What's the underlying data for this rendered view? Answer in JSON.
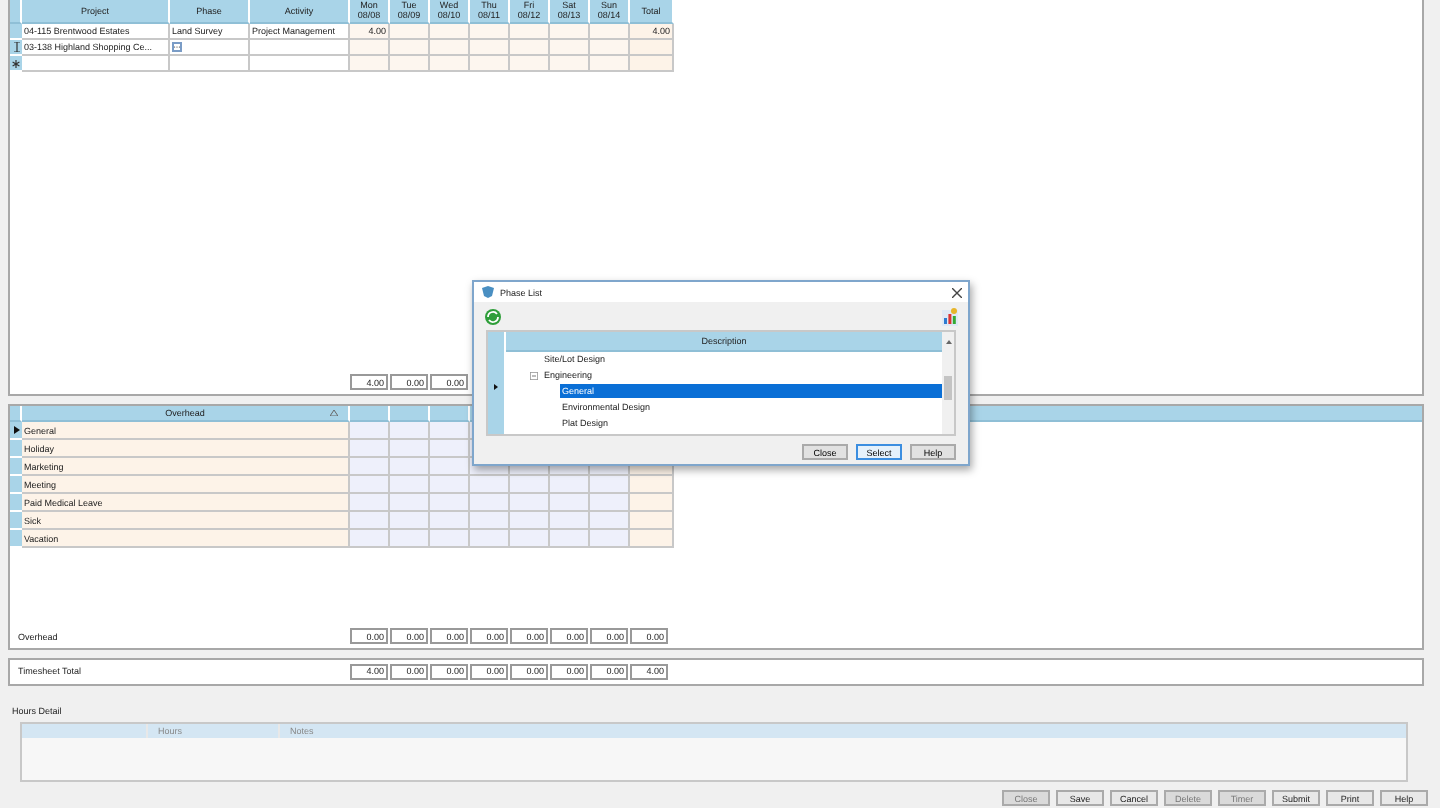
{
  "timesheet": {
    "columns": [
      "Project",
      "Phase",
      "Activity"
    ],
    "days": [
      {
        "day": "Mon",
        "date": "08/08"
      },
      {
        "day": "Tue",
        "date": "08/09"
      },
      {
        "day": "Wed",
        "date": "08/10"
      },
      {
        "day": "Thu",
        "date": "08/11"
      },
      {
        "day": "Fri",
        "date": "08/12"
      },
      {
        "day": "Sat",
        "date": "08/13"
      },
      {
        "day": "Sun",
        "date": "08/14"
      }
    ],
    "total_label": "Total",
    "rows": [
      {
        "editing": false,
        "new_row": false,
        "project": "04-115 Brentwood Estates",
        "phase": "Land Survey",
        "activity": "Project Management",
        "hours": {
          "mon": "4.00"
        },
        "total": "4.00",
        "phase_button": false
      },
      {
        "editing": true,
        "new_row": false,
        "project": "03-138 Highland Shopping Ce...",
        "phase_button": true
      },
      {
        "editing": false,
        "new_row": true,
        "phase_button": false
      }
    ],
    "totals": [
      "4.00",
      "0.00",
      "0.00"
    ]
  },
  "overhead": {
    "title": "Overhead",
    "rows": [
      {
        "name": "General",
        "current": true
      },
      {
        "name": "Holiday",
        "current": false
      },
      {
        "name": "Marketing",
        "current": false
      },
      {
        "name": "Meeting",
        "current": false
      },
      {
        "name": "Paid Medical Leave",
        "current": false
      },
      {
        "name": "Sick",
        "current": false
      },
      {
        "name": "Vacation",
        "current": false
      }
    ],
    "totals_label": "Overhead",
    "totals": [
      "0.00",
      "0.00",
      "0.00",
      "0.00",
      "0.00",
      "0.00",
      "0.00",
      "0.00"
    ]
  },
  "timesheet_total": {
    "label": "Timesheet Total",
    "values": [
      "4.00",
      "0.00",
      "0.00",
      "0.00",
      "0.00",
      "0.00",
      "0.00",
      "4.00"
    ]
  },
  "hours_detail": {
    "title": "Hours Detail",
    "columns": [
      "Hours",
      "Notes"
    ]
  },
  "buttons": [
    {
      "label": "Close",
      "disabled": true
    },
    {
      "label": "Save",
      "disabled": false
    },
    {
      "label": "Cancel",
      "disabled": false
    },
    {
      "label": "Delete",
      "disabled": true
    },
    {
      "label": "Timer",
      "disabled": true
    },
    {
      "label": "Submit",
      "disabled": false
    },
    {
      "label": "Print",
      "disabled": false
    },
    {
      "label": "Help",
      "disabled": false
    }
  ],
  "dialog": {
    "title": "Phase List",
    "column": "Description",
    "items": [
      {
        "label": "Site/Lot Design",
        "kind": "leaf",
        "selected": false
      },
      {
        "label": "Engineering",
        "kind": "group",
        "expanded": true,
        "children": [
          {
            "label": "General",
            "kind": "leaf",
            "selected": true
          },
          {
            "label": "Environmental Design",
            "kind": "leaf",
            "selected": false
          },
          {
            "label": "Plat Design",
            "kind": "leaf",
            "selected": false
          }
        ]
      }
    ],
    "buttons": [
      {
        "label": "Close",
        "focused": false
      },
      {
        "label": "Select",
        "focused": true
      },
      {
        "label": "Help",
        "focused": false
      }
    ]
  }
}
